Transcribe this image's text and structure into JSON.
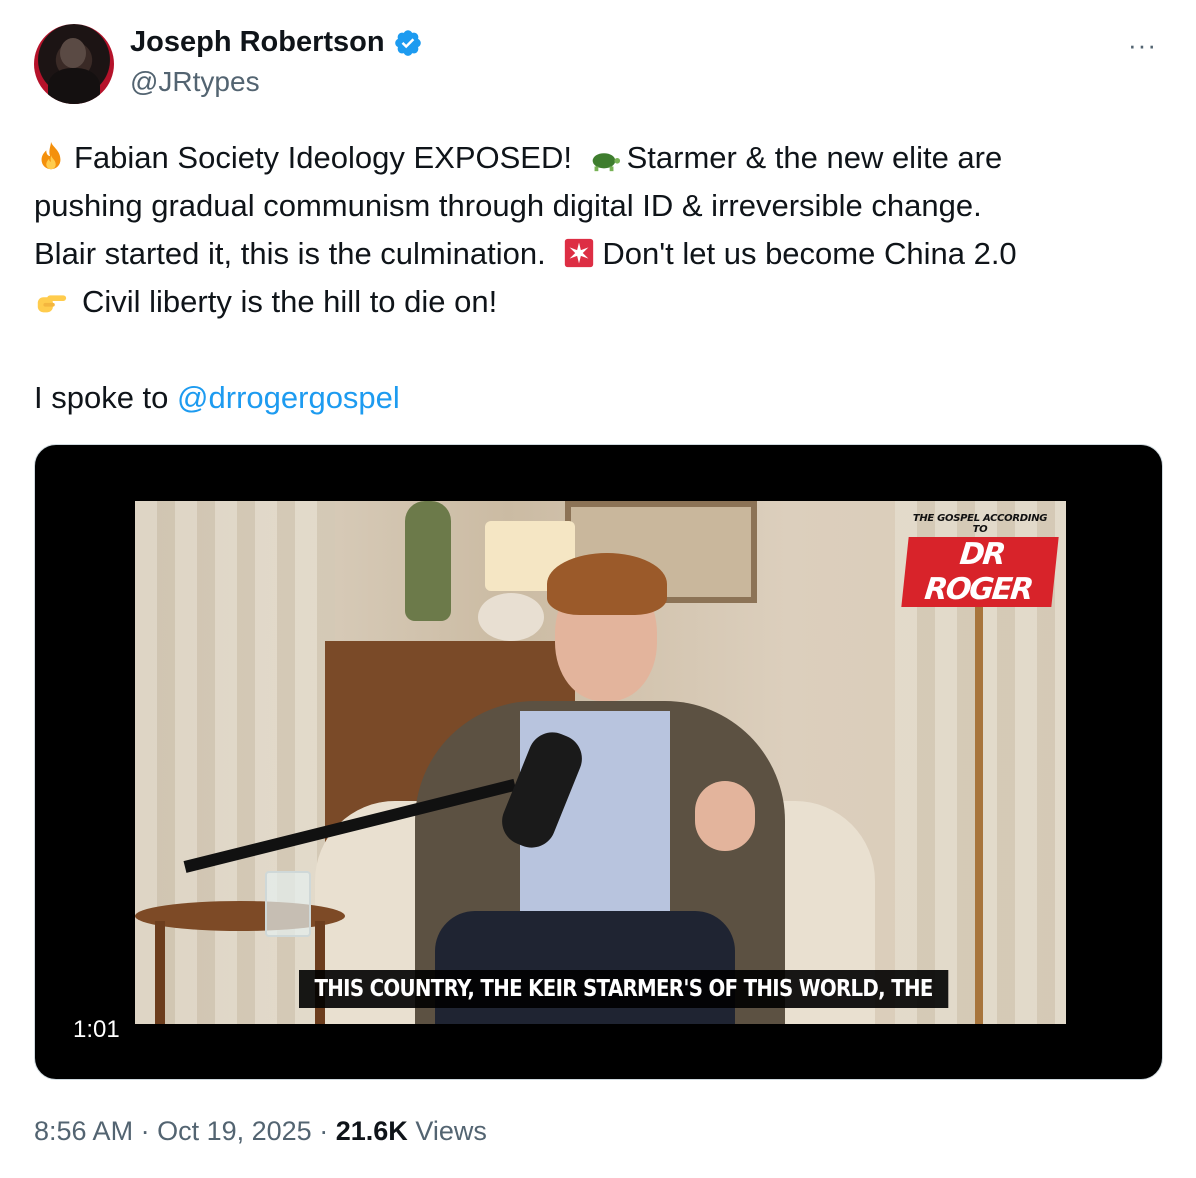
{
  "author": {
    "name": "Joseph Robertson",
    "handle": "@JRtypes",
    "verified_icon": "verified-badge-icon",
    "accent_color": "#1d9bf0"
  },
  "more_menu": "···",
  "tweet": {
    "line1_a": "Fabian Society Ideology EXPOSED!",
    "line1_b": "Starmer & the new elite are",
    "line2": "pushing gradual communism through digital ID & irreversible change.",
    "line3_a": "Blair started it, this is the culmination.",
    "line3_b": "Don't let us become China 2.0",
    "line4": "Civil liberty is the hill to die on!",
    "line5_prefix": "I spoke to",
    "mention": "@drrogergospel",
    "emojis": [
      "fire-emoji",
      "turtle-emoji",
      "siren-emoji",
      "pointing-hand-emoji"
    ]
  },
  "video": {
    "logo_small": "THE GOSPEL ACCORDING TO",
    "logo_big": "DR ROGER",
    "subtitle": "THIS COUNTRY, THE KEIR STARMER'S OF THIS WORLD, THE",
    "duration": "1:01"
  },
  "meta": {
    "time": "8:56 AM",
    "sep1": "·",
    "date": "Oct 19, 2025",
    "sep2": "·",
    "views_count": "21.6K",
    "views_label": "Views"
  }
}
